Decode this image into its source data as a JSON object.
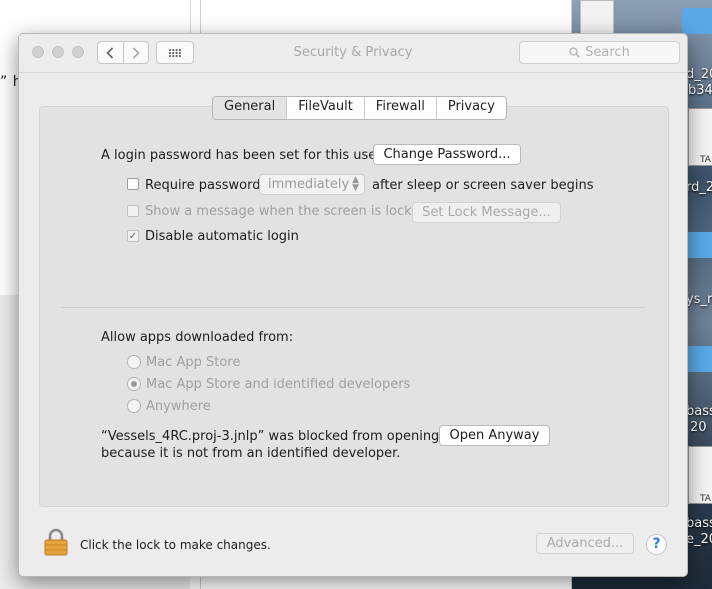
{
  "background": {
    "left_text": "” ha",
    "right_labels": [
      "d_20",
      "b34",
      "rd_2",
      "ys_re",
      "bass",
      "20",
      "bass",
      "e_20"
    ],
    "thumb_labels": [
      "TA",
      "TA"
    ]
  },
  "window": {
    "title": "Security & Privacy",
    "search_placeholder": "Search",
    "nav_back_icon": "chevron-left",
    "nav_forward_icon": "chevron-right",
    "grid_icon": "grid-dots"
  },
  "tabs": [
    {
      "label": "General",
      "active": true
    },
    {
      "label": "FileVault",
      "active": false
    },
    {
      "label": "Firewall",
      "active": false
    },
    {
      "label": "Privacy",
      "active": false
    }
  ],
  "general": {
    "login_password_text": "A login password has been set for this user",
    "change_password_label": "Change Password...",
    "require_password_label": "Require password",
    "require_password_checked": false,
    "require_password_delay": "immediately",
    "after_sleep_text": "after sleep or screen saver begins",
    "show_message_label": "Show a message when the screen is locked",
    "show_message_checked": false,
    "set_lock_message_label": "Set Lock Message...",
    "disable_auto_login_label": "Disable automatic login",
    "disable_auto_login_checked": true,
    "check_glyph": "✓"
  },
  "apps": {
    "heading": "Allow apps downloaded from:",
    "options": [
      {
        "label": "Mac App Store",
        "selected": false
      },
      {
        "label": "Mac App Store and identified developers",
        "selected": true
      },
      {
        "label": "Anywhere",
        "selected": false
      }
    ],
    "blocked_line1": "“Vessels_4RC.proj-3.jnlp” was blocked from opening",
    "blocked_line2": "because it is not from an identified developer.",
    "open_anyway_label": "Open Anyway"
  },
  "footer": {
    "lock_text": "Click the lock to make changes.",
    "advanced_label": "Advanced...",
    "help_label": "?",
    "lock_color": "#e6a23c"
  }
}
